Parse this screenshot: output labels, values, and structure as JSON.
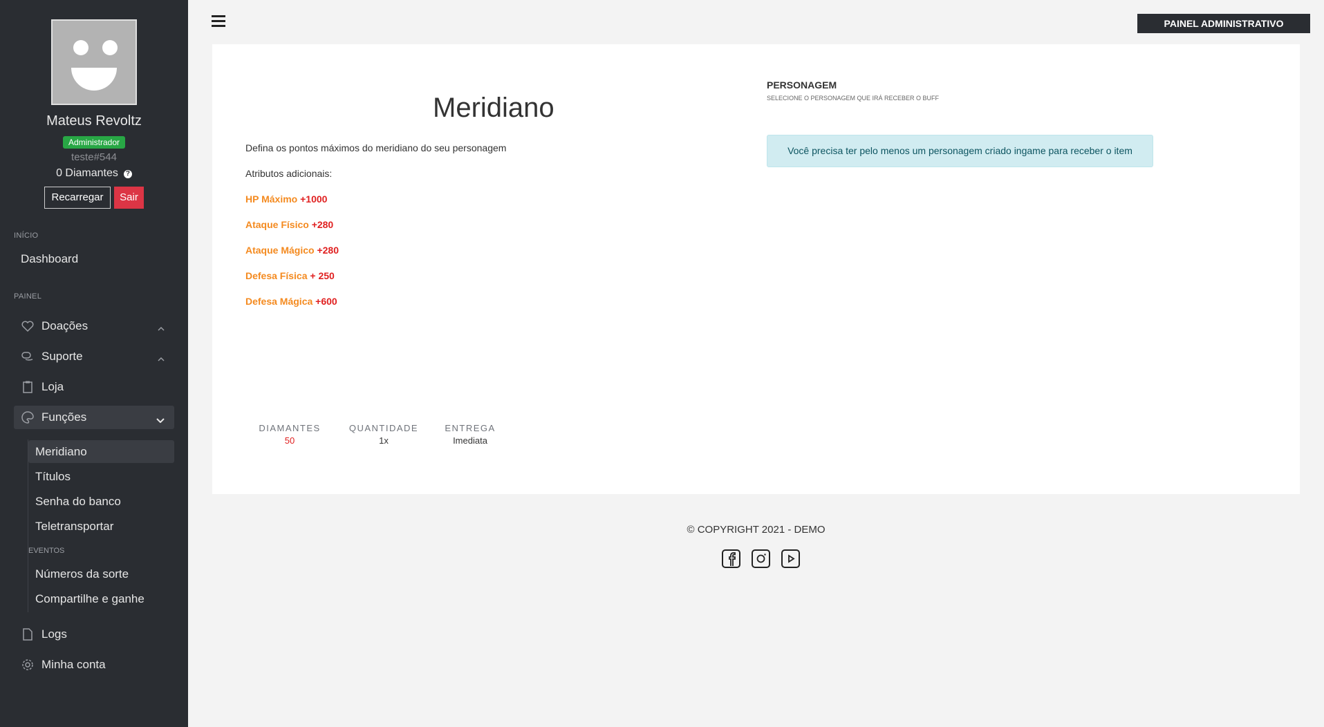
{
  "sidebar": {
    "user": {
      "name": "Mateus Revoltz",
      "role": "Administrador",
      "tag": "teste#544",
      "diamonds": "0 Diamantes"
    },
    "buttons": {
      "recharge": "Recarregar",
      "logout": "Sair"
    },
    "sections": {
      "start": "INÍCIO",
      "panel": "PAINEL",
      "events": "EVENTOS"
    },
    "items": {
      "dashboard": "Dashboard",
      "donations": "Doações",
      "support": "Suporte",
      "shop": "Loja",
      "functions": "Funções",
      "logs": "Logs",
      "account": "Minha conta"
    },
    "sub_items": {
      "meridian": "Meridiano",
      "titles": "Títulos",
      "bank_password": "Senha do banco",
      "teleport": "Teletransportar",
      "lucky_numbers": "Números da sorte",
      "share_win": "Compartilhe e ganhe"
    }
  },
  "header": {
    "admin_button": "PAINEL ADMINISTRATIVO"
  },
  "main": {
    "title": "Meridiano",
    "description": "Defina os pontos máximos  do meridiano do seu personagem",
    "attributes_heading": "Atributos adicionais:",
    "attributes": [
      {
        "name": "HP Máximo",
        "value": "+1000"
      },
      {
        "name": "Ataque Físico",
        "value": "+280"
      },
      {
        "name": "Ataque Mágico",
        "value": "+280"
      },
      {
        "name": "Defesa Física",
        "value": "+ 250"
      },
      {
        "name": "Defesa Mágica",
        "value": "+600"
      }
    ],
    "stats": {
      "diamonds_label": "DIAMANTES",
      "diamonds_value": "50",
      "quantity_label": "QUANTIDADE",
      "quantity_value": "1x",
      "delivery_label": "ENTREGA",
      "delivery_value": "Imediata"
    },
    "character": {
      "heading": "PERSONAGEM",
      "subheading": "SELECIONE O PERSONAGEM QUE IRÁ RECEBER O BUFF",
      "alert": "Você precisa ter pelo menos um personagem criado ingame para receber o item"
    }
  },
  "footer": {
    "copyright": "© COPYRIGHT 2021 - DEMO"
  },
  "colors": {
    "accent_orange": "#f48a1f",
    "value_red": "#e02020",
    "success": "#28a745",
    "danger": "#dc3545",
    "sidebar": "#2a2d32"
  }
}
